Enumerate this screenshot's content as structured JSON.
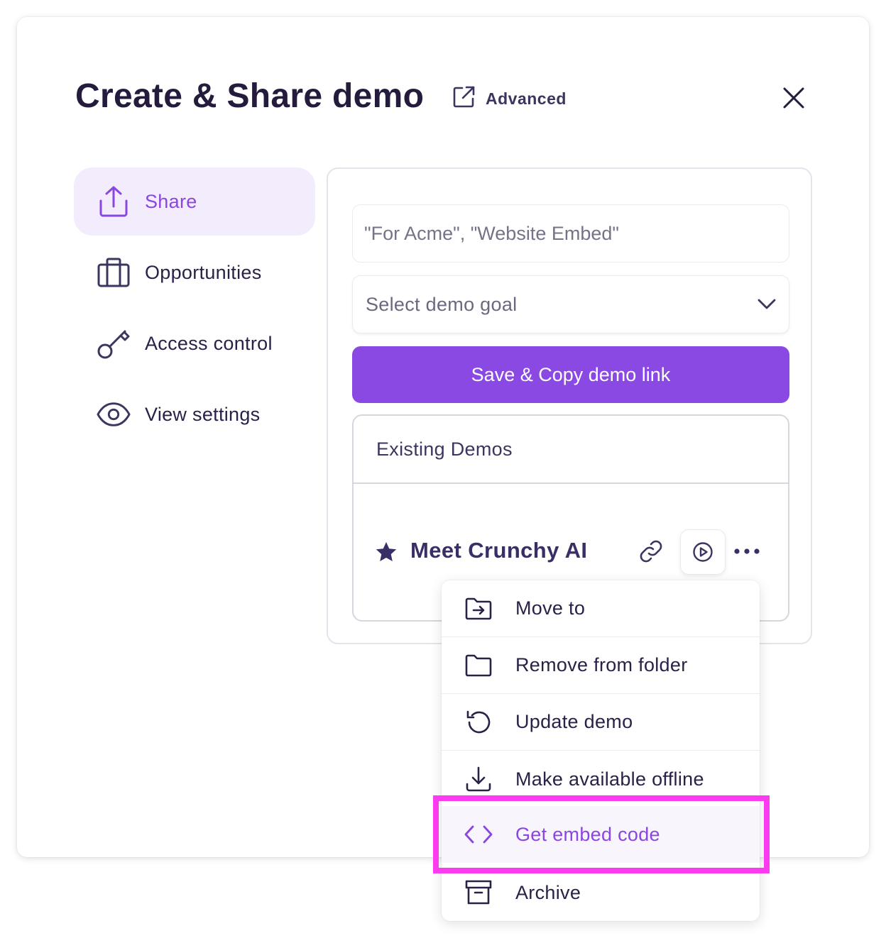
{
  "modal": {
    "title": "Create & Share demo",
    "advanced_label": "Advanced"
  },
  "sidebar": {
    "items": [
      {
        "label": "Share",
        "icon": "share-upload-icon",
        "active": true
      },
      {
        "label": "Opportunities",
        "icon": "briefcase-icon",
        "active": false
      },
      {
        "label": "Access control",
        "icon": "key-icon",
        "active": false
      },
      {
        "label": "View settings",
        "icon": "eye-icon",
        "active": false
      }
    ]
  },
  "share_panel": {
    "name_input": {
      "value": "",
      "placeholder": "\"For Acme\", \"Website Embed\""
    },
    "goal_select": {
      "selected": "Select demo goal"
    },
    "save_button": "Save & Copy demo link",
    "existing_demos": {
      "header": "Existing Demos",
      "demos": [
        {
          "name": "Meet Crunchy AI",
          "starred": true
        }
      ]
    }
  },
  "context_menu": {
    "items": [
      {
        "label": "Move to",
        "icon": "folder-move-icon"
      },
      {
        "label": "Remove from folder",
        "icon": "folder-icon"
      },
      {
        "label": "Update demo",
        "icon": "refresh-icon"
      },
      {
        "label": "Make available offline",
        "icon": "download-icon"
      },
      {
        "label": "Get embed code",
        "icon": "code-icon",
        "highlighted": true
      },
      {
        "label": "Archive",
        "icon": "archive-icon"
      }
    ]
  },
  "colors": {
    "accent": "#8b49e3",
    "active_bg": "#f3ecfd",
    "text_dark": "#241b3d",
    "annotation_highlight": "#fb3bef"
  }
}
